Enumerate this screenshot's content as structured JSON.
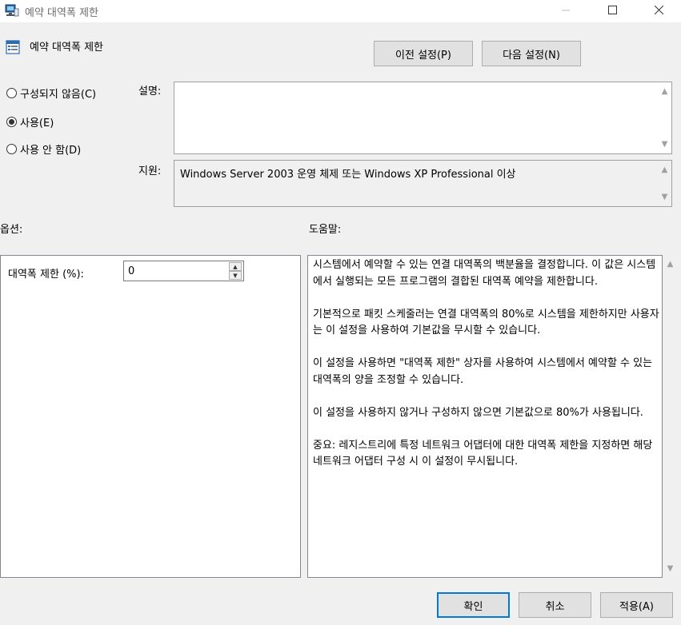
{
  "window": {
    "title": "예약 대역폭 제한",
    "icons": {
      "app": "computer-policy-icon",
      "minimize": "minimize-icon",
      "maximize": "maximize-icon",
      "close": "close-icon"
    }
  },
  "header": {
    "policy_title": "예약 대역폭 제한",
    "prev_button": "이전 설정(P)",
    "next_button": "다음 설정(N)"
  },
  "state": {
    "options": [
      {
        "label": "구성되지 않음(C)",
        "checked": false
      },
      {
        "label": "사용(E)",
        "checked": true
      },
      {
        "label": "사용 안 함(D)",
        "checked": false
      }
    ]
  },
  "fields": {
    "description_label": "설명:",
    "description_value": "",
    "supported_label": "지원:",
    "supported_value": "Windows Server 2003 운영 체제 또는 Windows XP Professional 이상"
  },
  "options_pane": {
    "heading": "옵션:",
    "bandwidth_label": "대역폭 제한 (%):",
    "bandwidth_value": "0"
  },
  "help_pane": {
    "heading": "도움말:",
    "paragraphs": [
      "시스템에서 예약할 수 있는 연결 대역폭의 백분율을 결정합니다. 이 값은 시스템에서 실행되는 모든 프로그램의 결합된 대역폭 예약을 제한합니다.",
      "기본적으로 패킷 스케줄러는 연결 대역폭의 80%로 시스템을 제한하지만 사용자는 이 설정을 사용하여 기본값을 무시할 수 있습니다.",
      "이 설정을 사용하면 \"대역폭 제한\" 상자를 사용하여 시스템에서 예약할 수 있는 대역폭의 양을 조정할 수 있습니다.",
      "이 설정을 사용하지 않거나 구성하지 않으면 기본값으로 80%가 사용됩니다.",
      "중요: 레지스트리에 특정 네트워크 어댑터에 대한 대역폭 제한을 지정하면 해당 네트워크 어댑터 구성 시 이 설정이 무시됩니다."
    ]
  },
  "footer": {
    "ok_button": "확인",
    "cancel_button": "취소",
    "apply_button": "적용(A)"
  },
  "colors": {
    "accent": "#0078d7",
    "window_bg": "#f0f0f0",
    "pane_bg": "#ffffff"
  }
}
